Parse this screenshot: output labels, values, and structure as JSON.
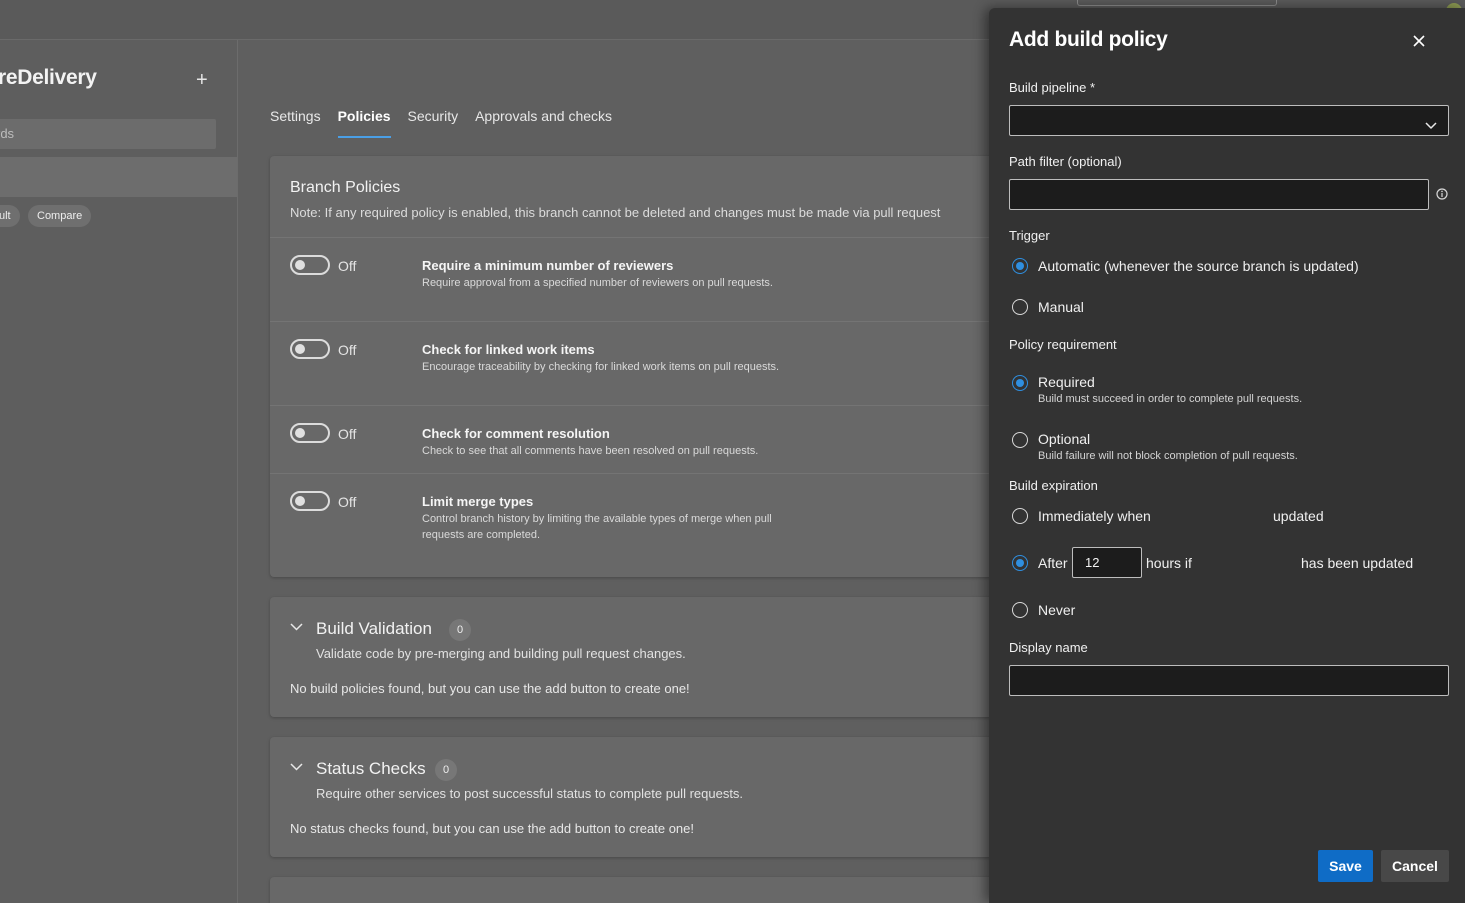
{
  "sidebar": {
    "title": "reDelivery",
    "search_placeholder": "rds",
    "chips": [
      "ult",
      "Compare"
    ]
  },
  "tabs": [
    {
      "label": "Settings",
      "active": false
    },
    {
      "label": "Policies",
      "active": true
    },
    {
      "label": "Security",
      "active": false
    },
    {
      "label": "Approvals and checks",
      "active": false
    }
  ],
  "branch_policies": {
    "title": "Branch Policies",
    "note": "Note: If any required policy is enabled, this branch cannot be deleted and changes must be made via pull request",
    "policies": [
      {
        "state": "Off",
        "title": "Require a minimum number of reviewers",
        "desc": "Require approval from a specified number of reviewers on pull requests."
      },
      {
        "state": "Off",
        "title": "Check for linked work items",
        "desc": "Encourage traceability by checking for linked work items on pull requests."
      },
      {
        "state": "Off",
        "title": "Check for comment resolution",
        "desc": "Check to see that all comments have been resolved on pull requests."
      },
      {
        "state": "Off",
        "title": "Limit merge types",
        "desc": "Control branch history by limiting the available types of merge when pull requests are completed."
      }
    ]
  },
  "build_validation": {
    "title": "Build Validation",
    "count": "0",
    "desc": "Validate code by pre-merging and building pull request changes.",
    "empty": "No build policies found, but you can use the add button to create one!"
  },
  "status_checks": {
    "title": "Status Checks",
    "count": "0",
    "desc": "Require other services to post successful status to complete pull requests.",
    "empty": "No status checks found, but you can use the add button to create one!"
  },
  "panel": {
    "title": "Add build policy",
    "build_pipeline_label": "Build pipeline *",
    "build_pipeline_value": "",
    "path_filter_label": "Path filter (optional)",
    "path_filter_value": "",
    "trigger_label": "Trigger",
    "trigger_options": [
      {
        "label": "Automatic (whenever the source branch is updated)",
        "selected": true
      },
      {
        "label": "Manual",
        "selected": false
      }
    ],
    "policy_req_label": "Policy requirement",
    "policy_req_options": [
      {
        "label": "Required",
        "sub": "Build must succeed in order to complete pull requests.",
        "selected": true
      },
      {
        "label": "Optional",
        "sub": "Build failure will not block completion of pull requests.",
        "selected": false
      }
    ],
    "build_expiration_label": "Build expiration",
    "expiration": {
      "immediately_label": "Immediately when",
      "immediately_suffix": "updated",
      "after_label": "After",
      "hours_value": "12",
      "hours_label": "hours if",
      "after_suffix": "has been updated",
      "never_label": "Never",
      "selected": "after"
    },
    "display_name_label": "Display name",
    "display_name_value": "",
    "save_label": "Save",
    "cancel_label": "Cancel"
  },
  "colors": {
    "accent": "#0f6cc6",
    "radio_selected": "#2f8fe0",
    "panel_bg": "#333333",
    "page_bg": "#5f5f5f"
  }
}
